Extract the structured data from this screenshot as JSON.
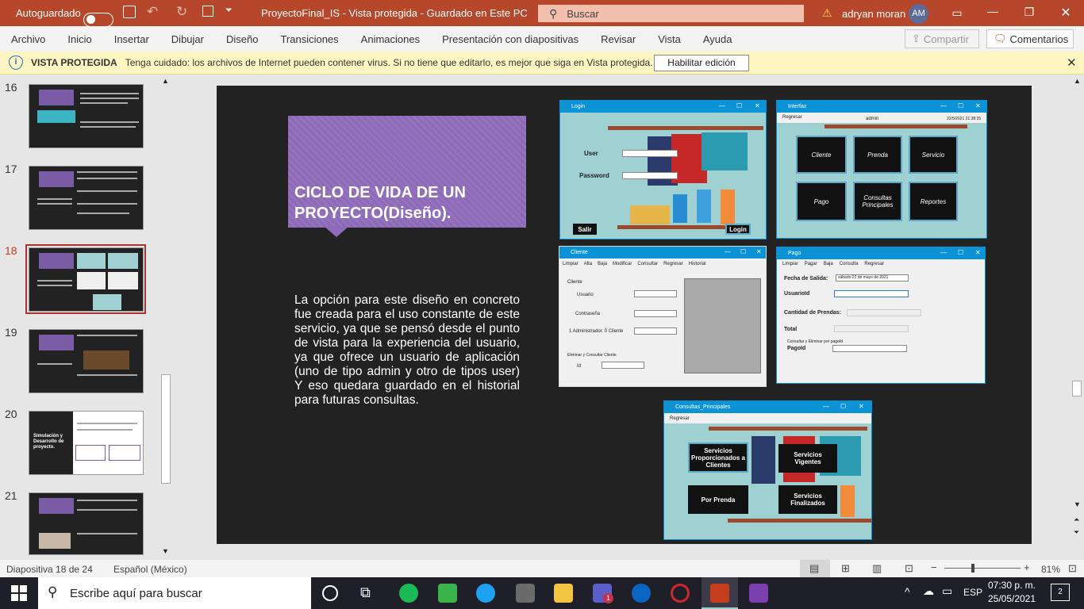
{
  "titlebar": {
    "autosave_label": "Autoguardado",
    "document_title": "ProyectoFinal_IS  -  Vista protegida  -  Guardado en Este PC",
    "search_placeholder": "Buscar",
    "user_name": "adryan moran",
    "user_initials": "AM",
    "accent": "#b7472a"
  },
  "ribbon": {
    "tabs": [
      "Archivo",
      "Inicio",
      "Insertar",
      "Dibujar",
      "Diseño",
      "Transiciones",
      "Animaciones",
      "Presentación con diapositivas",
      "Revisar",
      "Vista",
      "Ayuda"
    ],
    "share_label": "Compartir",
    "comments_label": "Comentarios"
  },
  "protected": {
    "title": "VISTA PROTEGIDA",
    "message": "Tenga cuidado: los archivos de Internet pueden contener virus. Si no tiene que editarlo, es mejor que siga en Vista protegida.",
    "enable_label": "Habilitar edición"
  },
  "thumbnails": [
    {
      "num": "16",
      "selected": false
    },
    {
      "num": "17",
      "selected": false
    },
    {
      "num": "18",
      "selected": true
    },
    {
      "num": "19",
      "selected": false
    },
    {
      "num": "20",
      "selected": false,
      "text": "Simulación y Desarrollo de proyecto."
    },
    {
      "num": "21",
      "selected": false
    }
  ],
  "slide": {
    "title": "CICLO DE VIDA DE UN PROYECTO(Diseño).",
    "body": "La opción para este diseño en concreto fue creada para el uso constante de este servicio, ya que se pensó desde el punto de vista para la experiencia del usuario, ya que ofrece un usuario de aplicación (uno de tipo admin y otro de tipos user) Y eso quedara guardado en el historial para futuras consultas.",
    "login": {
      "title": "Login",
      "user": "User",
      "password": "Password",
      "exit": "Salir",
      "login": "Login"
    },
    "interfaz": {
      "title": "Interfaz",
      "menu": "Regresar",
      "user": "admin",
      "datetime": "22/5/2021 21:38:35",
      "buttons": [
        "Cliente",
        "Prenda",
        "Servicio",
        "Pago",
        "Consultas Principales",
        "Reportes"
      ]
    },
    "cliente": {
      "title": "Cliente",
      "menu": [
        "Limpiar",
        "Alta",
        "Baja",
        "Modificar",
        "Consultar",
        "Regresar",
        "Historial"
      ],
      "group": "Cliente",
      "fields": [
        "Usuario",
        "Contraseña",
        "1 Administrador. 0 Cliente"
      ],
      "group2": "Eliminar y Consultar Cliente",
      "id": "Id"
    },
    "pago": {
      "title": "Pago",
      "menu": [
        "Limpiar",
        "Pagar",
        "Baja",
        "Consulta",
        "Regresar"
      ],
      "fecha_label": "Fecha de Salida:",
      "fecha_value": "sábado   22 de      mayo      de 2021",
      "usuario": "UsuarioId",
      "cantidad": "Cantidad de Prendas:",
      "total": "Total",
      "group": "Consultar y Eliminar por pagoId",
      "pagoid": "PagoId"
    },
    "consultas": {
      "title": "Consultas_Principales",
      "menu": "Regresar",
      "buttons": [
        "Servicios Proporcionados a Clientes",
        "Servicios Vigentes",
        "Por Prenda",
        "Servicios Finalizados"
      ]
    }
  },
  "status": {
    "slide_info": "Diapositiva 18 de 24",
    "language": "Español (México)",
    "zoom": "81%"
  },
  "taskbar": {
    "search_placeholder": "Escribe aquí para buscar",
    "lang": "ESP",
    "time": "07:30 p. m.",
    "date": "25/05/2021",
    "notif_count": "2",
    "teams_badge": "1"
  }
}
